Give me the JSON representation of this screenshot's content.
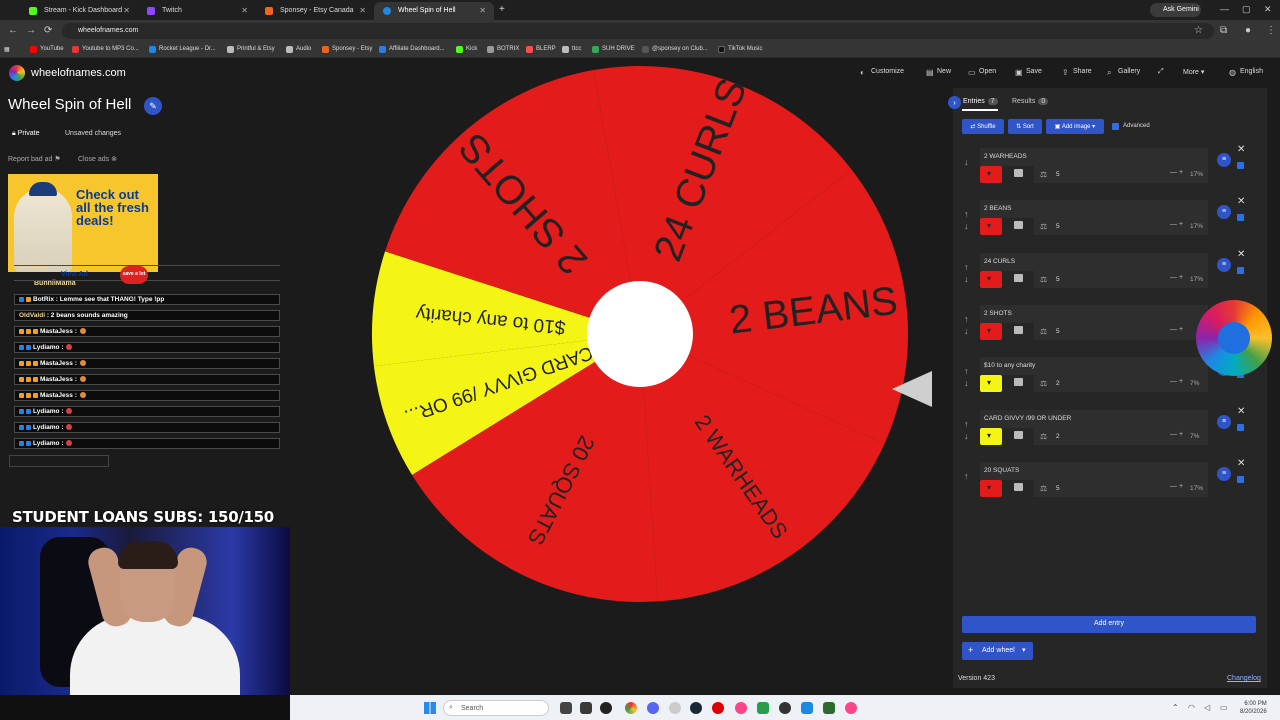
{
  "browser": {
    "tabs": [
      {
        "label": "Stream - Kick Dashboard",
        "color": "#53fc18"
      },
      {
        "label": "Twitch",
        "color": "#9146ff"
      },
      {
        "label": "Sponsey - Etsy Canada",
        "color": "#f1641e"
      },
      {
        "label": "Wheel Spin of Hell",
        "color": "#1e88e5"
      }
    ],
    "new_tab": "+",
    "ask_gemini": "Ask Gemini",
    "url": "wheelofnames.com",
    "bookmarks": [
      {
        "label": "YouTube",
        "color": "#ff0000"
      },
      {
        "label": "Youtube to MP3 Co...",
        "color": "#e53935"
      },
      {
        "label": "Rocket League - Dr...",
        "color": "#1e88e5"
      },
      {
        "label": "Printful & Etsy",
        "color": "#bbbbbb"
      },
      {
        "label": "Audio",
        "color": "#bbbbbb"
      },
      {
        "label": "Sponsey - Etsy",
        "color": "#f1641e"
      },
      {
        "label": "Affiliate Dashboard...",
        "color": "#2a7fe0"
      },
      {
        "label": "Kick",
        "color": "#53fc18"
      },
      {
        "label": "BOTRIX",
        "color": "#999999"
      },
      {
        "label": "BLERP",
        "color": "#ff4d4d"
      },
      {
        "label": "ttcc",
        "color": "#bbbbbb"
      },
      {
        "label": "SUH DRIVE",
        "color": "#34a853"
      },
      {
        "label": "@sponsey on Club...",
        "color": "#555555"
      },
      {
        "label": "TikTok Music",
        "color": "#111111"
      }
    ]
  },
  "site": {
    "brand": "wheelofnames.com",
    "menu": [
      {
        "label": "Customize",
        "icon": "palette-icon"
      },
      {
        "label": "New",
        "icon": "new-icon"
      },
      {
        "label": "Open",
        "icon": "folder-icon"
      },
      {
        "label": "Save",
        "icon": "save-icon"
      },
      {
        "label": "Share",
        "icon": "share-icon"
      },
      {
        "label": "Gallery",
        "icon": "search-icon"
      },
      {
        "label": "More",
        "icon": "chevron-down-icon"
      },
      {
        "label": "English",
        "icon": "globe-icon"
      }
    ],
    "wheel_title": "Wheel Spin of Hell",
    "private_label": "Private",
    "unsaved_label": "Unsaved changes",
    "report_ad": "Report bad ad",
    "close_ads": "Close ads",
    "ad_text": "Check out all the fresh deals!",
    "ad_view": "View Ad",
    "ad_badge": "save a lot"
  },
  "stream_overlay": {
    "top_names": [
      "OldValdi",
      "BunniiMama"
    ],
    "chat": [
      {
        "user": "BotRix",
        "msg": ": Lemme see that THANG! Type !pp"
      },
      {
        "user": "OldValdi",
        "msg": ": 2 beans sounds amazing"
      },
      {
        "user": "MastaJess",
        "msg": ":"
      },
      {
        "user": "Lydiamo",
        "msg": ":"
      },
      {
        "user": "MastaJess",
        "msg": ":"
      },
      {
        "user": "MastaJess",
        "msg": ":"
      },
      {
        "user": "MastaJess",
        "msg": ":"
      },
      {
        "user": "Lydiamo",
        "msg": ":"
      },
      {
        "user": "Lydiamo",
        "msg": ":"
      },
      {
        "user": "Lydiamo",
        "msg": ":"
      }
    ],
    "student_loans": "STUDENT LOANS SUBS: 150/150"
  },
  "wheel": {
    "segments": [
      {
        "label": "2 BEANS",
        "color": "#e31b1b",
        "weight": 5
      },
      {
        "label": "2 WARHEADS",
        "color": "#e31b1b",
        "weight": 5
      },
      {
        "label": "20 SQUATS",
        "color": "#e31b1b",
        "weight": 5
      },
      {
        "label": "CARD GIVVY /99 OR...",
        "color": "#f5f515",
        "weight": 2
      },
      {
        "label": "$10 to any charity",
        "color": "#f5f515",
        "weight": 2
      },
      {
        "label": "2 SHOTS",
        "color": "#e31b1b",
        "weight": 5
      },
      {
        "label": "24 CURLS",
        "color": "#e31b1b",
        "weight": 5
      }
    ]
  },
  "panel": {
    "tab_entries": "Entries",
    "entries_count": "7",
    "tab_results": "Results",
    "results_count": "0",
    "shuffle": "Shuffle",
    "sort": "Sort",
    "add_image": "Add image",
    "advanced": "Advanced",
    "entries": [
      {
        "name": "2 WARHEADS",
        "weight": "5",
        "pct": "17%",
        "color": "#e31b1b"
      },
      {
        "name": "2 BEANS",
        "weight": "5",
        "pct": "17%",
        "color": "#e31b1b"
      },
      {
        "name": "24 CURLS",
        "weight": "5",
        "pct": "17%",
        "color": "#e31b1b"
      },
      {
        "name": "2 SHOTS",
        "weight": "5",
        "pct": "",
        "color": "#e31b1b"
      },
      {
        "name": "$10 to any charity",
        "weight": "2",
        "pct": "7%",
        "color": "#f5f515"
      },
      {
        "name": "CARD GIVVY /99 OR UNDER",
        "weight": "2",
        "pct": "7%",
        "color": "#f5f515"
      },
      {
        "name": "20 SQUATS",
        "weight": "5",
        "pct": "17%",
        "color": "#e31b1b"
      }
    ],
    "add_entry": "Add entry",
    "add_wheel": "Add wheel",
    "version": "Version 423",
    "changelog": "Changelog"
  },
  "taskbar": {
    "search": "Search",
    "time": "6:00 PM",
    "date": "8/20/2026"
  }
}
